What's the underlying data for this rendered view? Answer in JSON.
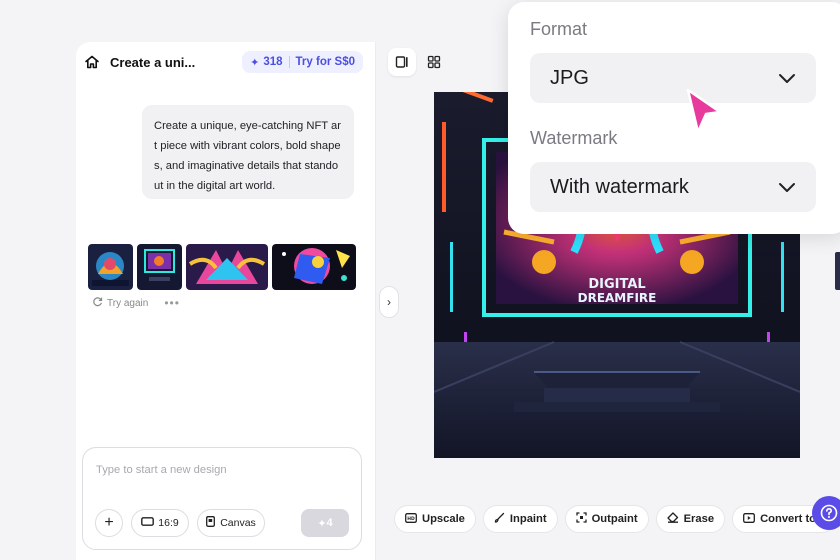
{
  "chat": {
    "title": "Create a uni...",
    "credits": "318",
    "try_label": "Try for S$0",
    "prompt": "Create a unique, eye-catching NFT art piece with vibrant colors, bold shapes, and imaginative details that standout in the digital art world.",
    "try_again": "Try again",
    "input_placeholder": "Type to start a new design",
    "ratio_label": "16:9",
    "canvas_label": "Canvas",
    "send_cost": "4"
  },
  "actions": [
    "Upscale",
    "Inpaint",
    "Outpaint",
    "Erase",
    "Convert to v"
  ],
  "image_text": {
    "line1": "DIGITAL",
    "line2": "DREAMFIRE"
  },
  "popover": {
    "format_label": "Format",
    "format_value": "JPG",
    "watermark_label": "Watermark",
    "watermark_value": "With watermark"
  },
  "colors": {
    "accent": "#4b4fe0",
    "help_button": "#5b4ce8",
    "cursor": "#e83a9c"
  }
}
